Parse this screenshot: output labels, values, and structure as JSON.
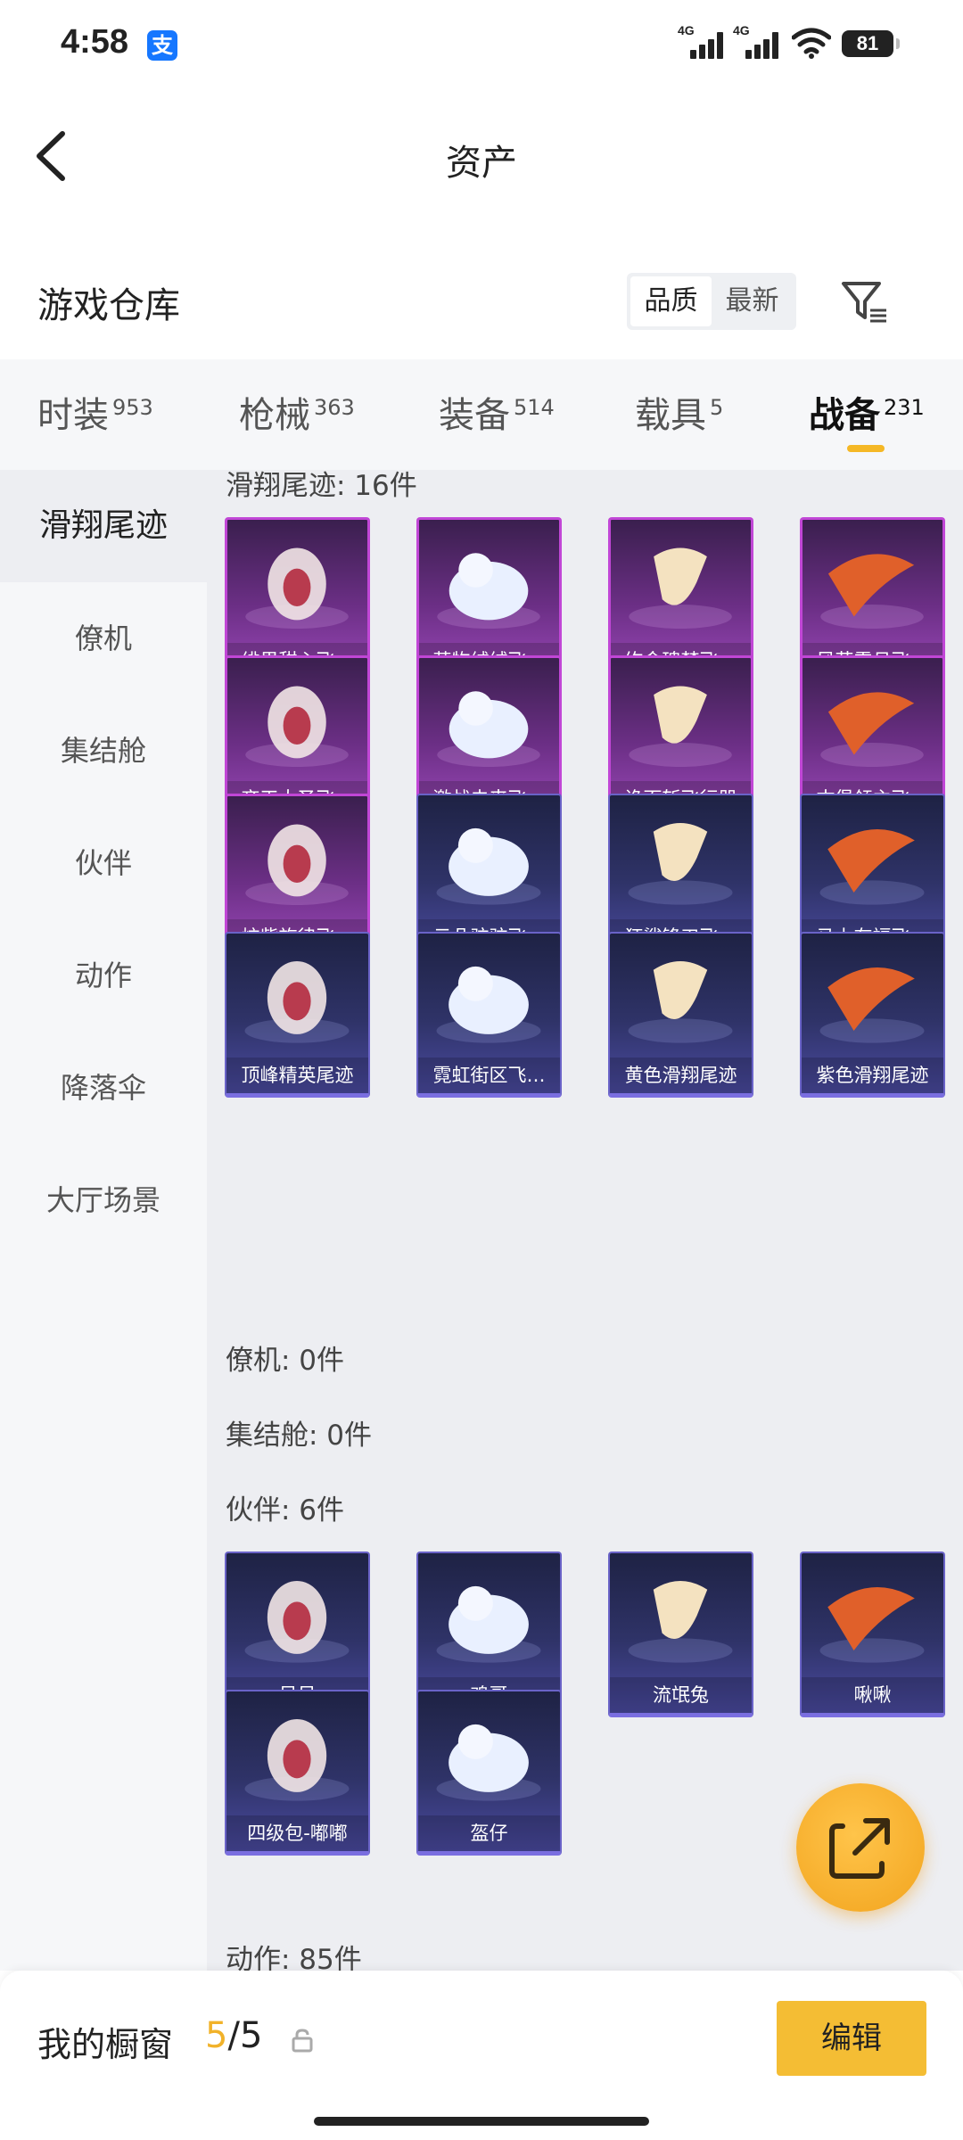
{
  "status_bar": {
    "time": "4:58",
    "app_badge": "支",
    "signal_1": "4G",
    "signal_2": "4G",
    "battery": "81"
  },
  "nav": {
    "title": "资产"
  },
  "warehouse": {
    "title": "游戏仓库",
    "sort_options": [
      "品质",
      "最新"
    ],
    "active_sort": "品质"
  },
  "tabs": [
    {
      "label": "时装",
      "count": "953"
    },
    {
      "label": "枪械",
      "count": "363"
    },
    {
      "label": "装备",
      "count": "514"
    },
    {
      "label": "载具",
      "count": "5"
    },
    {
      "label": "战备",
      "count": "231",
      "active": true
    }
  ],
  "sidebar": [
    {
      "label": "滑翔尾迹",
      "active": true
    },
    {
      "label": "僚机"
    },
    {
      "label": "集结舱"
    },
    {
      "label": "伙伴"
    },
    {
      "label": "动作"
    },
    {
      "label": "降落伞"
    },
    {
      "label": "大厅场景"
    }
  ],
  "sections": {
    "glide_trails": "滑翔尾迹: 16件",
    "wingman": "僚机: 0件",
    "assembly_pod": "集结舱: 0件",
    "partner": "伙伴: 6件",
    "emote": "动作: 85件"
  },
  "trail_items": [
    {
      "name": "绯果甜心飞…",
      "quality": "purple"
    },
    {
      "name": "萌物绒绒飞…",
      "quality": "purple"
    },
    {
      "name": "绚金瑰梦飞…",
      "quality": "purple"
    },
    {
      "name": "风花雪月飞…",
      "quality": "purple"
    },
    {
      "name": "齐天大圣飞…",
      "quality": "purple"
    },
    {
      "name": "激战未来飞…",
      "quality": "purple"
    },
    {
      "name": "诡面斩飞行器",
      "quality": "purple"
    },
    {
      "name": "古堡领主飞…",
      "quality": "purple"
    },
    {
      "name": "炫紫旋律飞…",
      "quality": "purple"
    },
    {
      "name": "云朵驼驼飞…",
      "quality": "blue"
    },
    {
      "name": "狂鲨锋刃飞…",
      "quality": "blue"
    },
    {
      "name": "马上有福飞…",
      "quality": "blue"
    },
    {
      "name": "顶峰精英尾迹",
      "quality": "blue"
    },
    {
      "name": "霓虹街区飞…",
      "quality": "blue"
    },
    {
      "name": "黄色滑翔尾迹",
      "quality": "blue"
    },
    {
      "name": "紫色滑翔尾迹",
      "quality": "blue"
    }
  ],
  "partner_items": [
    {
      "name": "呆呆",
      "quality": "blue"
    },
    {
      "name": "鸡哥",
      "quality": "blue"
    },
    {
      "name": "流氓兔",
      "quality": "blue"
    },
    {
      "name": "啾啾",
      "quality": "blue"
    },
    {
      "name": "四级包-嘟嘟",
      "quality": "blue"
    },
    {
      "name": "盔仔",
      "quality": "blue"
    }
  ],
  "showcase": {
    "label": "我的橱窗",
    "current": "5",
    "separator": "/",
    "total": "5",
    "edit_label": "编辑"
  },
  "colors": {
    "accent": "#f4bd34",
    "purple_quality": "#c146d6",
    "blue_quality": "#6a63c8"
  }
}
